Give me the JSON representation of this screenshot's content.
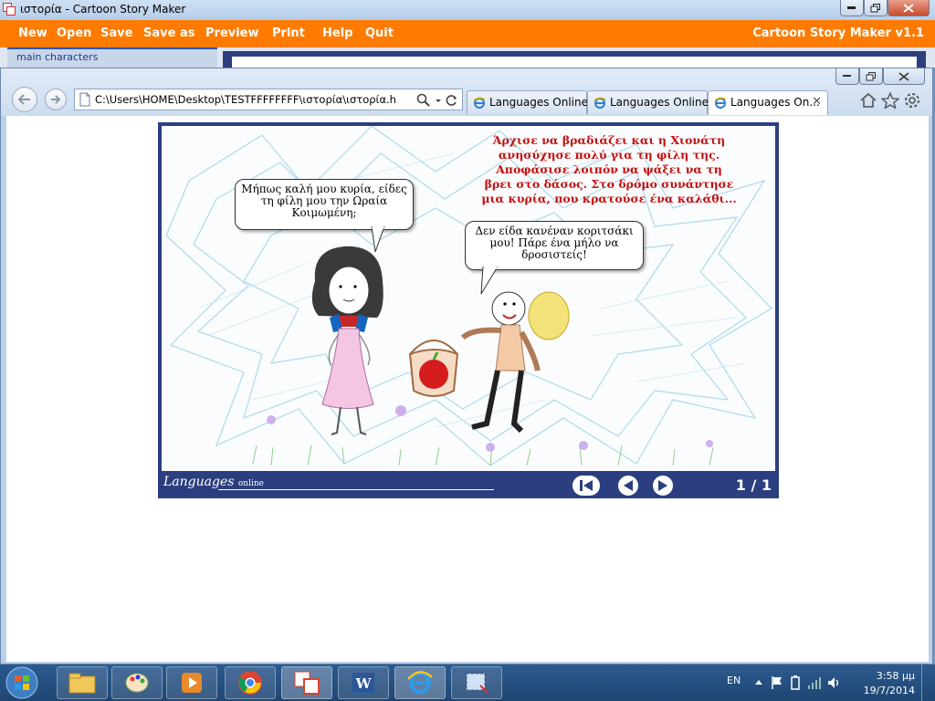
{
  "app": {
    "title": "ιστορία - Cartoon Story Maker",
    "menu": [
      "New",
      "Open",
      "Save",
      "Save as",
      "Preview",
      "Print",
      "Help",
      "Quit"
    ],
    "brand": "Cartoon Story Maker v1.1",
    "main_characters_label": "main characters",
    "stage_hint": "Άρχισε να βραδιάζει και η Χιονάτη"
  },
  "browser": {
    "address": "C:\\Users\\HOME\\Desktop\\TESTFFFFFFFF\\ιστορία\\ιστορία.html",
    "tabs": [
      {
        "label": "Languages Online..."
      },
      {
        "label": "Languages Online..."
      },
      {
        "label": "Languages On..."
      }
    ]
  },
  "story": {
    "caption": "Άρχισε να βραδιάζει και η Χιονάτη ανησύχησε πολύ για τη φίλη της. Αποφάσισε λοιπόν να ψάξει να τη βρει στο δάσος. Στο δρόμο συνάντησε μια κυρία, που κρατούσε ένα καλάθι...",
    "bubble1": "Μήπως καλή μου κυρία, είδες τη φίλη μου την Ωραία Κοιμωμένη;",
    "bubble2": "Δεν είδα κανέναν κοριτσάκι μου! Πάρε ένα μήλο να δροσιστείς!",
    "logo_main": "Languages",
    "logo_sub": "online",
    "pager": "1 / 1"
  },
  "taskbar": {
    "lang": "EN",
    "time": "3:58 μμ",
    "date": "19/7/2014"
  },
  "colors": {
    "menu_orange": "#ff7b00",
    "story_frame": "#2b3f80",
    "caption_red": "#c51010"
  }
}
